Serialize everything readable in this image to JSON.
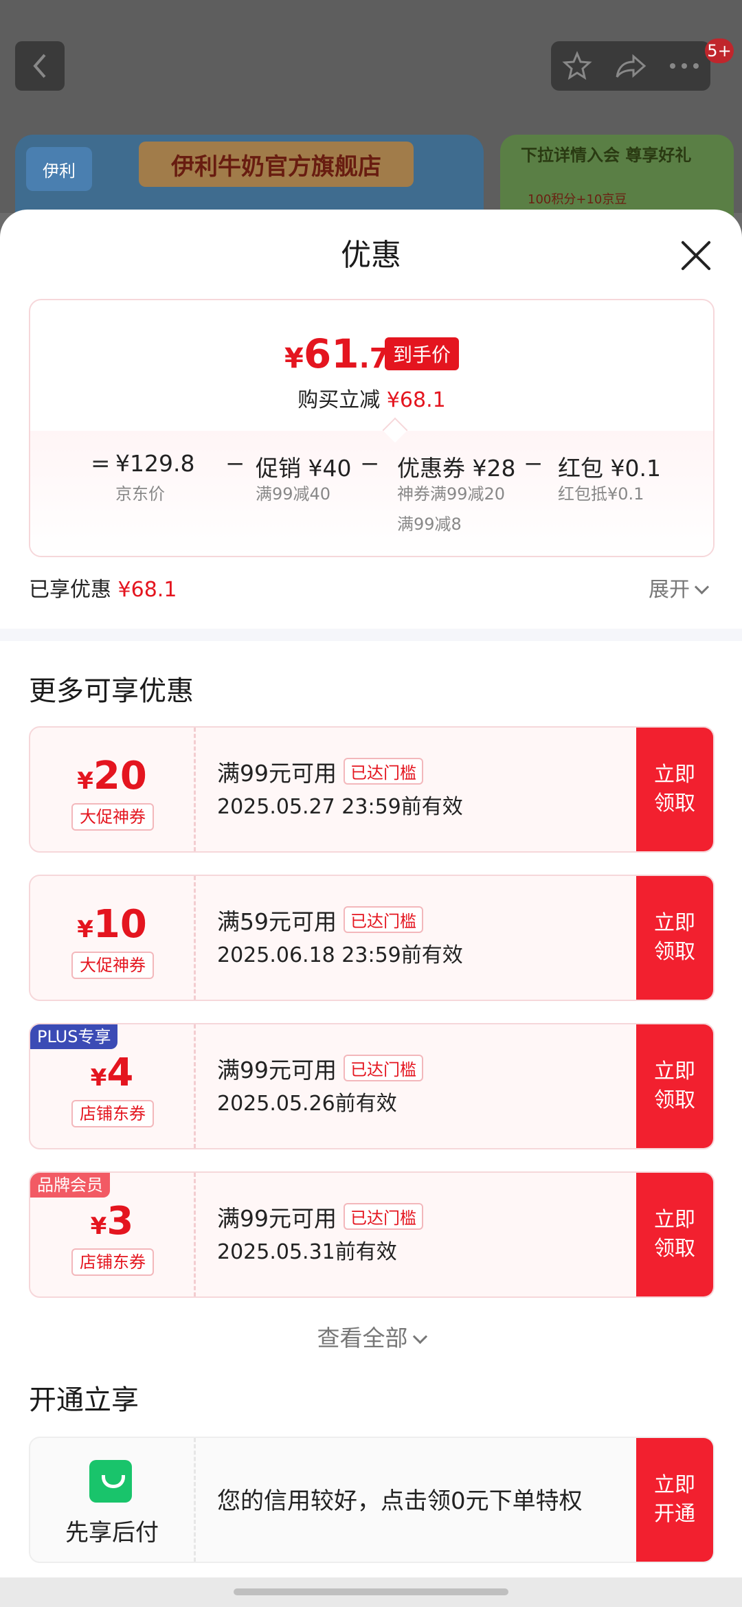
{
  "background": {
    "badge": "5+",
    "banner_title": "伊利牛奶官方旗舰店",
    "banner_logo": "伊利",
    "banner2_title": "下拉详情入会 尊享好礼",
    "banner2_text": "100积分+10京豆"
  },
  "sheet": {
    "title": "优惠",
    "price": {
      "currency": "¥",
      "int": "61",
      "dec": ".7",
      "tag": "到手价",
      "save_label": "购买立减",
      "save_value": "¥68.1"
    },
    "calc": {
      "eq": "=",
      "minus": "−",
      "items": [
        {
          "amount": "¥129.8",
          "sub": "京东价",
          "sub2": ""
        },
        {
          "amount": "促销 ¥40",
          "sub": "满99减40",
          "sub2": ""
        },
        {
          "amount": "优惠券 ¥28",
          "sub": "神券满99减20",
          "sub2": "满99减8"
        },
        {
          "amount": "红包 ¥0.1",
          "sub": "红包抵¥0.1",
          "sub2": ""
        }
      ]
    },
    "enjoyed_label": "已享优惠",
    "enjoyed_value": "¥68.1",
    "expand_label": "展开",
    "more_title": "更多可享优惠",
    "coupons": [
      {
        "currency": "¥",
        "value": "20",
        "type": "大促神券",
        "title": "满99元可用",
        "tag": "已达门槛",
        "date": "2025.05.27 23:59前有效",
        "btn1": "立即",
        "btn2": "领取",
        "corner": ""
      },
      {
        "currency": "¥",
        "value": "10",
        "type": "大促神券",
        "title": "满59元可用",
        "tag": "已达门槛",
        "date": "2025.06.18 23:59前有效",
        "btn1": "立即",
        "btn2": "领取",
        "corner": ""
      },
      {
        "currency": "¥",
        "value": "4",
        "type": "店铺东券",
        "title": "满99元可用",
        "tag": "已达门槛",
        "date": "2025.05.26前有效",
        "btn1": "立即",
        "btn2": "领取",
        "corner": "PLUS专享"
      },
      {
        "currency": "¥",
        "value": "3",
        "type": "店铺东券",
        "title": "满99元可用",
        "tag": "已达门槛",
        "date": "2025.05.31前有效",
        "btn1": "立即",
        "btn2": "领取",
        "corner": "品牌会员"
      }
    ],
    "view_all": "查看全部",
    "open_title": "开通立享",
    "pay": {
      "label": "先享后付",
      "text": "您的信用较好，点击领0元下单特权",
      "btn1": "立即",
      "btn2": "开通"
    }
  }
}
